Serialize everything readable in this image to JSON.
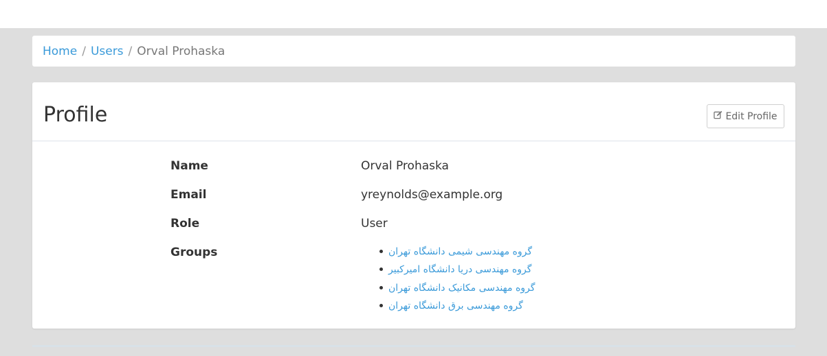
{
  "breadcrumb": {
    "home": "Home",
    "users": "Users",
    "current": "Orval Prohaska",
    "separator": "/"
  },
  "panel": {
    "title": "Profile",
    "edit_label": "Edit Profile",
    "edit_icon": "edit-icon"
  },
  "profile": {
    "name_label": "Name",
    "name_value": "Orval Prohaska",
    "email_label": "Email",
    "email_value": "yreynolds@example.org",
    "role_label": "Role",
    "role_value": "User",
    "groups_label": "Groups",
    "groups": [
      "گروه مهندسی شیمی دانشگاه تهران",
      "گروه مهندسی دریا دانشگاه امیرکبیر",
      "گروه مهندسی مکانیک دانشگاه تهران",
      "گروه مهندسی برق دانشگاه تهران"
    ]
  },
  "colors": {
    "link": "#3a9ad9",
    "background": "#dedede",
    "panel": "#ffffff"
  }
}
